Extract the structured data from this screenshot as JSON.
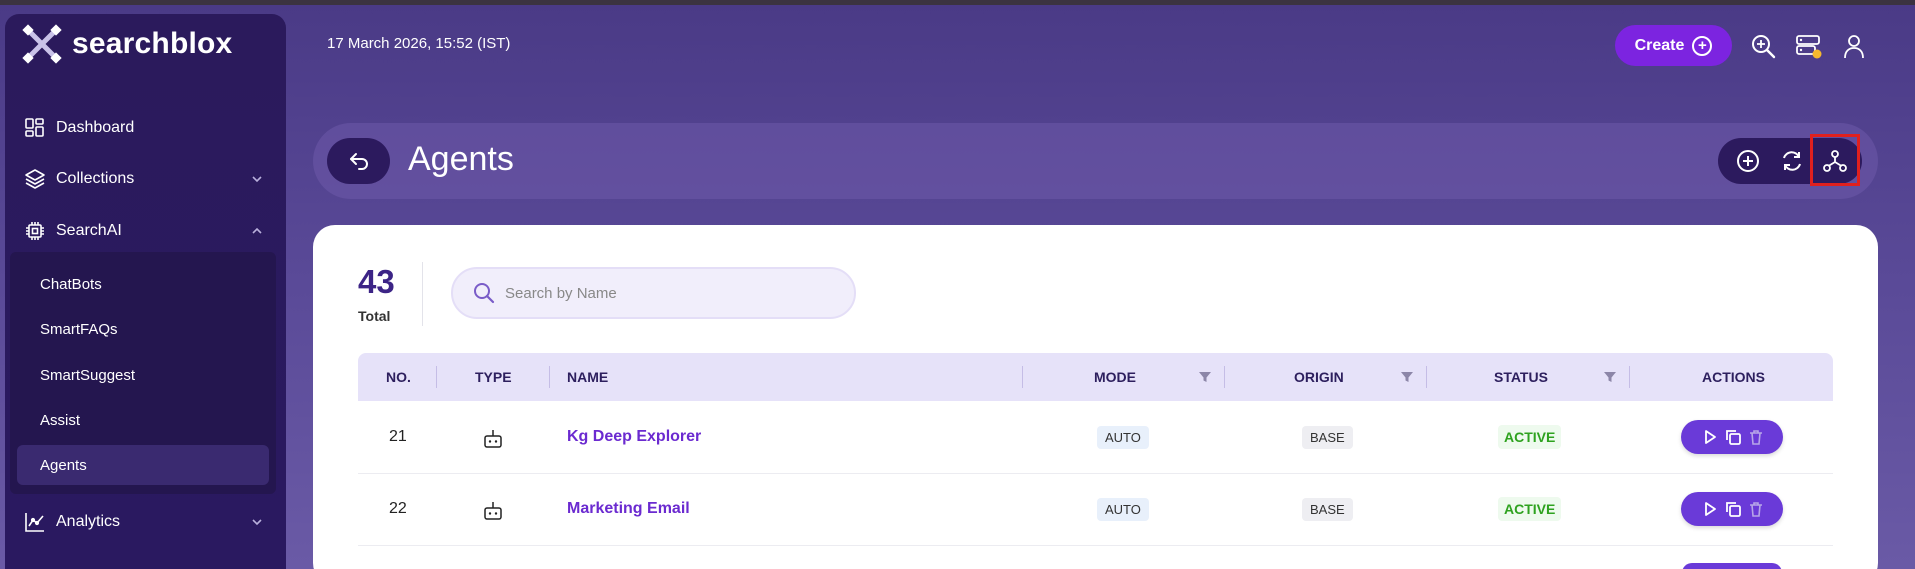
{
  "brand": {
    "name": "searchblox"
  },
  "sidebar": {
    "items": [
      {
        "label": "Dashboard",
        "icon": "dashboard-icon"
      },
      {
        "label": "Collections",
        "icon": "layers-icon",
        "expandable": true
      },
      {
        "label": "SearchAI",
        "icon": "chip-icon",
        "expandable": true,
        "expanded": true
      },
      {
        "label": "Analytics",
        "icon": "analytics-icon",
        "expandable": true
      }
    ],
    "subitems": [
      {
        "label": "ChatBots"
      },
      {
        "label": "SmartFAQs"
      },
      {
        "label": "SmartSuggest"
      },
      {
        "label": "Assist"
      },
      {
        "label": "Agents",
        "active": true
      }
    ]
  },
  "topbar": {
    "datetime": "17 March 2026, 15:52 (IST)",
    "create_label": "Create"
  },
  "header": {
    "title": "Agents"
  },
  "summary": {
    "total": "43",
    "total_label": "Total"
  },
  "search": {
    "placeholder": "Search by Name"
  },
  "table": {
    "columns": [
      "NO.",
      "TYPE",
      "NAME",
      "MODE",
      "ORIGIN",
      "STATUS",
      "ACTIONS"
    ],
    "rows": [
      {
        "no": "21",
        "type": "robot-icon",
        "name": "Kg Deep Explorer",
        "mode": "AUTO",
        "origin": "BASE",
        "status": "ACTIVE"
      },
      {
        "no": "22",
        "type": "robot-icon",
        "name": "Marketing Email",
        "mode": "AUTO",
        "origin": "BASE",
        "status": "ACTIVE"
      }
    ]
  },
  "colors": {
    "accent": "#7c24e0",
    "sidebar": "#2b1a5c",
    "active_status": "#2ea21f",
    "link": "#6b2ad0",
    "highlight": "#e0201e"
  }
}
